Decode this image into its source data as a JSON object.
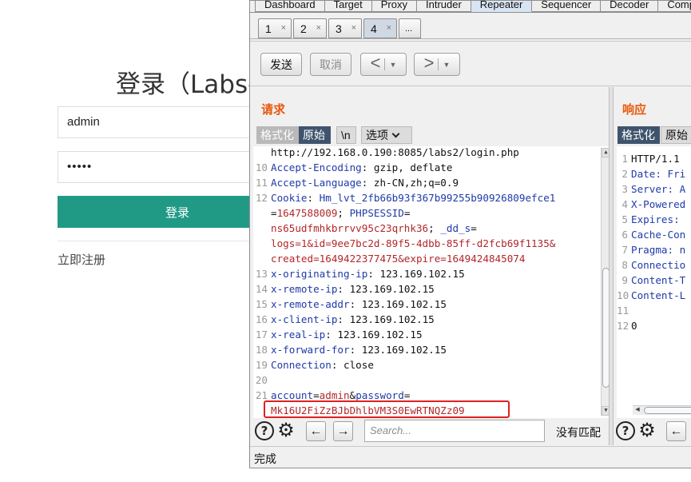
{
  "login": {
    "title": "登录（Labs-",
    "username_value": "admin",
    "password_mask": "•••••",
    "submit_label": "登录",
    "register_link": "立即注册"
  },
  "burp": {
    "main_tabs": [
      "Dashboard",
      "Target",
      "Proxy",
      "Intruder",
      "Repeater",
      "Sequencer",
      "Decoder",
      "Compar"
    ],
    "active_main_tab": "Repeater",
    "sub_tabs": [
      "1",
      "2",
      "3",
      "4"
    ],
    "sub_tab_close": "×",
    "sub_tab_more": "...",
    "active_sub_tab": "4",
    "toolbar": {
      "send_label": "发送",
      "cancel_label": "取消",
      "back_glyph": "<",
      "forward_glyph": ">",
      "dropdown_glyph": "▼"
    },
    "request": {
      "title": "请求",
      "pretty_label": "格式化",
      "raw_label": "原始",
      "newline_label": "\\n",
      "options_label": "选项",
      "line_first": "http://192.168.0.190:8085/labs2/login.php",
      "lines": [
        {
          "n": "10",
          "key": "Accept-Encoding",
          "val": "gzip, deflate"
        },
        {
          "n": "11",
          "key": "Accept-Language",
          "val": "zh-CN,zh;q=0.9"
        }
      ],
      "cookie": {
        "n": "12",
        "key": "Cookie",
        "hm_key": "Hm_lvt_2fb66b93f367b99255b90926809efce1",
        "hm_val": "1647588009",
        "sess_key": "PHPSESSID",
        "sess_val": "ns65udfmhkbrrvv95c23qrhk36",
        "dd_key": "_dd_s",
        "dd_val1": "logs=1&id=9ee7bc2d-89f5-4dbb-85ff-d2fcb69f1135&",
        "dd_val2": "created=1649422377475&expire=1649424845074"
      },
      "lines2": [
        {
          "n": "13",
          "key": "x-originating-ip",
          "val": "123.169.102.15"
        },
        {
          "n": "14",
          "key": "x-remote-ip",
          "val": "123.169.102.15"
        },
        {
          "n": "15",
          "key": "x-remote-addr",
          "val": "123.169.102.15"
        },
        {
          "n": "16",
          "key": "x-client-ip",
          "val": "123.169.102.15"
        },
        {
          "n": "17",
          "key": "x-real-ip",
          "val": "123.169.102.15"
        },
        {
          "n": "18",
          "key": "x-forward-for",
          "val": "123.169.102.15"
        },
        {
          "n": "19",
          "key": "Connection",
          "val": "close"
        }
      ],
      "blank_line": "20",
      "body": {
        "n": "21",
        "account_key": "account",
        "account_val": "admin",
        "password_key": "password",
        "password_val": "Mk16U2FiZzBJbDhlbVM3S0EwRTNQZz09"
      }
    },
    "response": {
      "title": "响应",
      "pretty_label": "格式化",
      "raw_label": "原始",
      "lines": [
        {
          "n": "1",
          "text": "HTTP/1.1"
        },
        {
          "n": "2",
          "text": "Date: Fri"
        },
        {
          "n": "3",
          "text": "Server: A"
        },
        {
          "n": "4",
          "text": "X-Powered"
        },
        {
          "n": "5",
          "text": "Expires: "
        },
        {
          "n": "6",
          "text": "Cache-Con"
        },
        {
          "n": "7",
          "text": "Pragma: n"
        },
        {
          "n": "8",
          "text": "Connectio"
        },
        {
          "n": "9",
          "text": "Content-T"
        },
        {
          "n": "10",
          "text": "Content-L"
        },
        {
          "n": "11",
          "text": ""
        },
        {
          "n": "12",
          "text": "0"
        }
      ]
    },
    "search": {
      "placeholder": "Search...",
      "no_match": "没有匹配",
      "help_glyph": "?",
      "gear_glyph": "⚙",
      "prev_glyph": "←",
      "next_glyph": "→"
    },
    "status": "完成"
  }
}
